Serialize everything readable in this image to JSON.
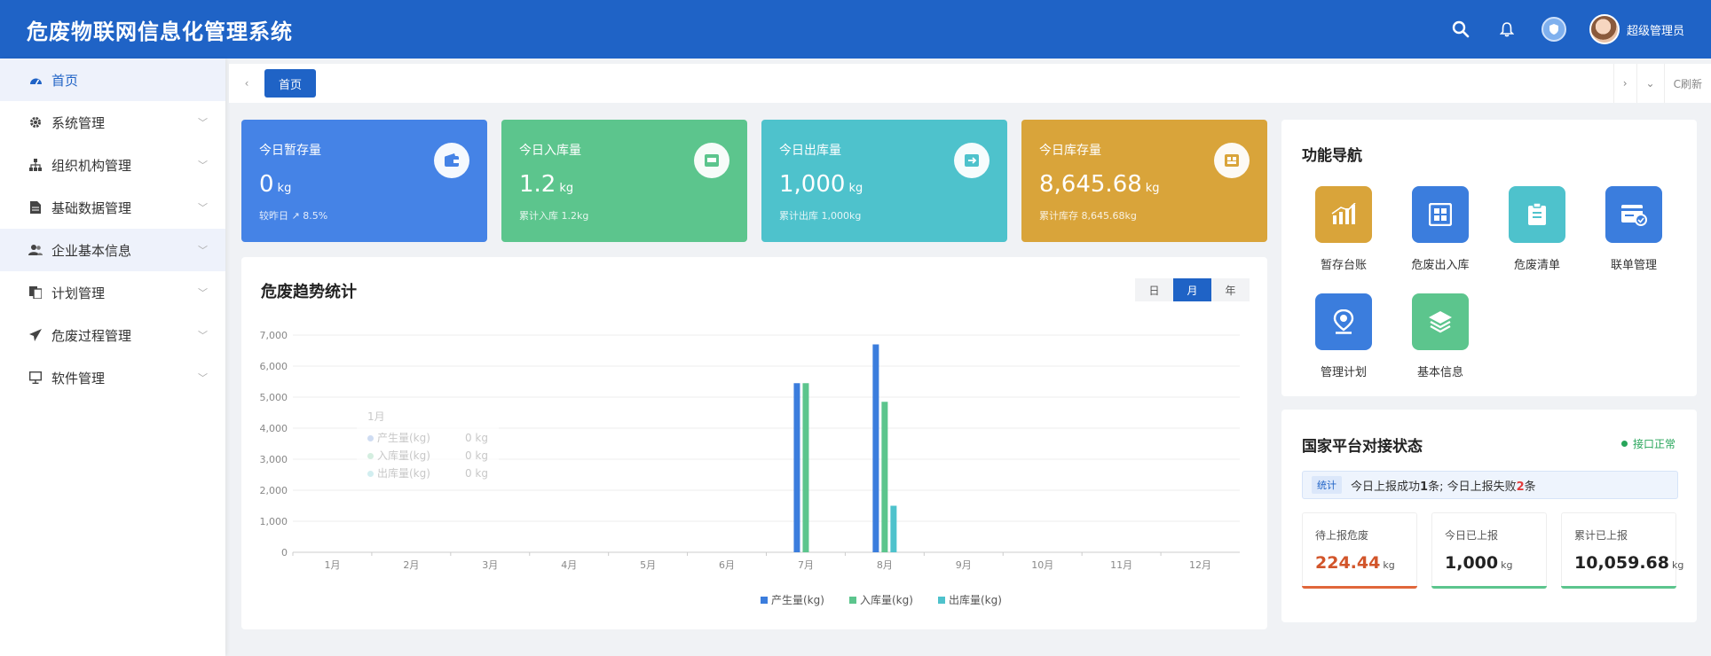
{
  "header": {
    "title": "危废物联网信息化管理系统",
    "user_name": "超级管理员"
  },
  "sidebar": {
    "items": [
      {
        "label": "首页",
        "icon": "dashboard-icon"
      },
      {
        "label": "系统管理",
        "icon": "gear-icon"
      },
      {
        "label": "组织机构管理",
        "icon": "org-chart-icon"
      },
      {
        "label": "基础数据管理",
        "icon": "document-icon"
      },
      {
        "label": "企业基本信息",
        "icon": "users-icon"
      },
      {
        "label": "计划管理",
        "icon": "copy-icon"
      },
      {
        "label": "危废过程管理",
        "icon": "send-icon"
      },
      {
        "label": "软件管理",
        "icon": "monitor-icon"
      }
    ]
  },
  "tabs": {
    "home": "首页",
    "refresh": "C刷新"
  },
  "stats": [
    {
      "title": "今日暂存量",
      "value": "0",
      "unit": "kg",
      "sub": "较昨日 ↗ 8.5%",
      "color": "#4583e6"
    },
    {
      "title": "今日入库量",
      "value": "1.2",
      "unit": "kg",
      "sub": "累计入库 1.2kg",
      "color": "#5cc58d"
    },
    {
      "title": "今日出库量",
      "value": "1,000",
      "unit": "kg",
      "sub": "累计出库 1,000kg",
      "color": "#4ec2cc"
    },
    {
      "title": "今日库存量",
      "value": "8,645.68",
      "unit": "kg",
      "sub": "累计库存 8,645.68kg",
      "color": "#d9a43a"
    }
  ],
  "chart": {
    "title": "危废趋势统计",
    "periods": [
      "日",
      "月",
      "年"
    ],
    "active_period": "月",
    "tooltip": {
      "title": "1月",
      "rows": [
        {
          "name": "产生量(kg)",
          "value": "0 kg"
        },
        {
          "name": "入库量(kg)",
          "value": "0 kg"
        },
        {
          "name": "出库量(kg)",
          "value": "0 kg"
        }
      ]
    }
  },
  "chart_data": {
    "type": "bar",
    "title": "危废趋势统计",
    "categories": [
      "1月",
      "2月",
      "3月",
      "4月",
      "5月",
      "6月",
      "7月",
      "8月",
      "9月",
      "10月",
      "11月",
      "12月"
    ],
    "series": [
      {
        "name": "产生量(kg)",
        "color": "#3b7ddd",
        "values": [
          0,
          0,
          0,
          0,
          0,
          0,
          5450,
          6700,
          0,
          0,
          0,
          0
        ]
      },
      {
        "name": "入库量(kg)",
        "color": "#5cc58d",
        "values": [
          0,
          0,
          0,
          0,
          0,
          0,
          5450,
          4850,
          0,
          0,
          0,
          0
        ]
      },
      {
        "name": "出库量(kg)",
        "color": "#4ec2cc",
        "values": [
          0,
          0,
          0,
          0,
          0,
          0,
          0,
          1500,
          0,
          0,
          0,
          0
        ]
      }
    ],
    "ylim": [
      0,
      7000
    ],
    "yticks": [
      "0",
      "1,000",
      "2,000",
      "3,000",
      "4,000",
      "5,000",
      "6,000",
      "7,000"
    ],
    "legend": "bottom"
  },
  "nav": {
    "title": "功能导航",
    "items": [
      {
        "label": "暂存台账",
        "icon": "bar-chart-icon",
        "color": "#d9a43a"
      },
      {
        "label": "危废出入库",
        "icon": "grid-icon",
        "color": "#3b7ddd"
      },
      {
        "label": "危废清单",
        "icon": "clipboard-icon",
        "color": "#4ec2cc"
      },
      {
        "label": "联单管理",
        "icon": "card-icon",
        "color": "#3b7ddd"
      },
      {
        "label": "管理计划",
        "icon": "pin-icon",
        "color": "#3b7ddd"
      },
      {
        "label": "基本信息",
        "icon": "layers-icon",
        "color": "#5cc58d"
      }
    ]
  },
  "national": {
    "title": "国家平台对接状态",
    "status": "接口正常",
    "tag": "统计",
    "info_a": "今日上报成功",
    "success_count": "1",
    "info_b": "条;  今日上报失败",
    "fail_count": "2",
    "info_c": "条",
    "cards": [
      {
        "label": "待上报危废",
        "value": "224.44",
        "unit": "kg",
        "color": "#e0663a"
      },
      {
        "label": "今日已上报",
        "value": "1,000",
        "unit": "kg",
        "color": "#5cc58d"
      },
      {
        "label": "累计已上报",
        "value": "10,059.68",
        "unit": "kg",
        "color": "#5cc58d"
      }
    ]
  }
}
